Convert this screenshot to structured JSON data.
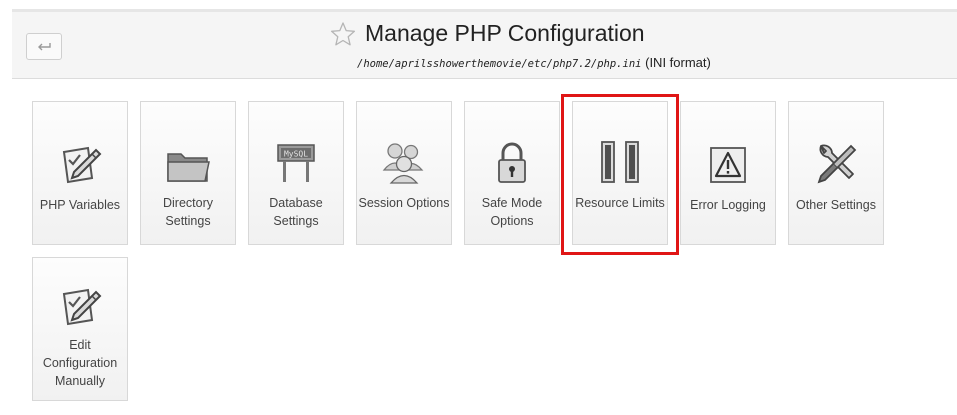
{
  "header": {
    "back_icon": "back-arrow-icon",
    "star_icon": "star-outline-icon",
    "title": "Manage PHP Configuration",
    "path": "/home/aprilsshowerthemovie/etc/php7.2/php.ini",
    "format": "(INI format)"
  },
  "tiles": [
    {
      "label": "PHP Variables",
      "icon": "edit-clipboard-icon"
    },
    {
      "label": "Directory Settings",
      "icon": "folder-icon"
    },
    {
      "label": "Database Settings",
      "icon": "mysql-sign-icon"
    },
    {
      "label": "Session Options",
      "icon": "users-icon"
    },
    {
      "label": "Safe Mode Options",
      "icon": "padlock-icon"
    },
    {
      "label": "Resource Limits",
      "icon": "pause-bars-icon"
    },
    {
      "label": "Error Logging",
      "icon": "warning-icon"
    },
    {
      "label": "Other Settings",
      "icon": "tools-icon"
    },
    {
      "label": "Edit Configuration Manually",
      "icon": "edit-clipboard-icon"
    }
  ],
  "highlight_color": "#e01616"
}
